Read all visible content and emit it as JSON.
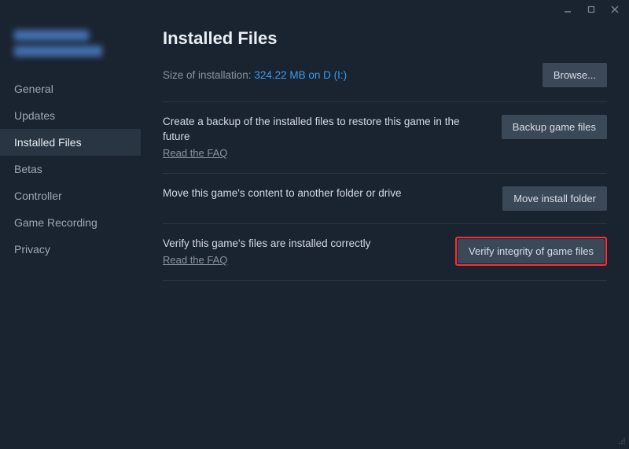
{
  "titlebar": {
    "minimize": "minimize",
    "maximize": "maximize",
    "close": "close"
  },
  "sidebar": {
    "items": [
      {
        "label": "General"
      },
      {
        "label": "Updates"
      },
      {
        "label": "Installed Files"
      },
      {
        "label": "Betas"
      },
      {
        "label": "Controller"
      },
      {
        "label": "Game Recording"
      },
      {
        "label": "Privacy"
      }
    ]
  },
  "content": {
    "heading": "Installed Files",
    "size_label": "Size of installation: ",
    "size_value": "324.22 MB on D (I:)",
    "browse_button": "Browse...",
    "backup": {
      "text": "Create a backup of the installed files to restore this game in the future",
      "faq": "Read the FAQ",
      "button": "Backup game files"
    },
    "move": {
      "text": "Move this game's content to another folder or drive",
      "button": "Move install folder"
    },
    "verify": {
      "text": "Verify this game's files are installed correctly",
      "faq": "Read the FAQ",
      "button": "Verify integrity of game files"
    }
  }
}
